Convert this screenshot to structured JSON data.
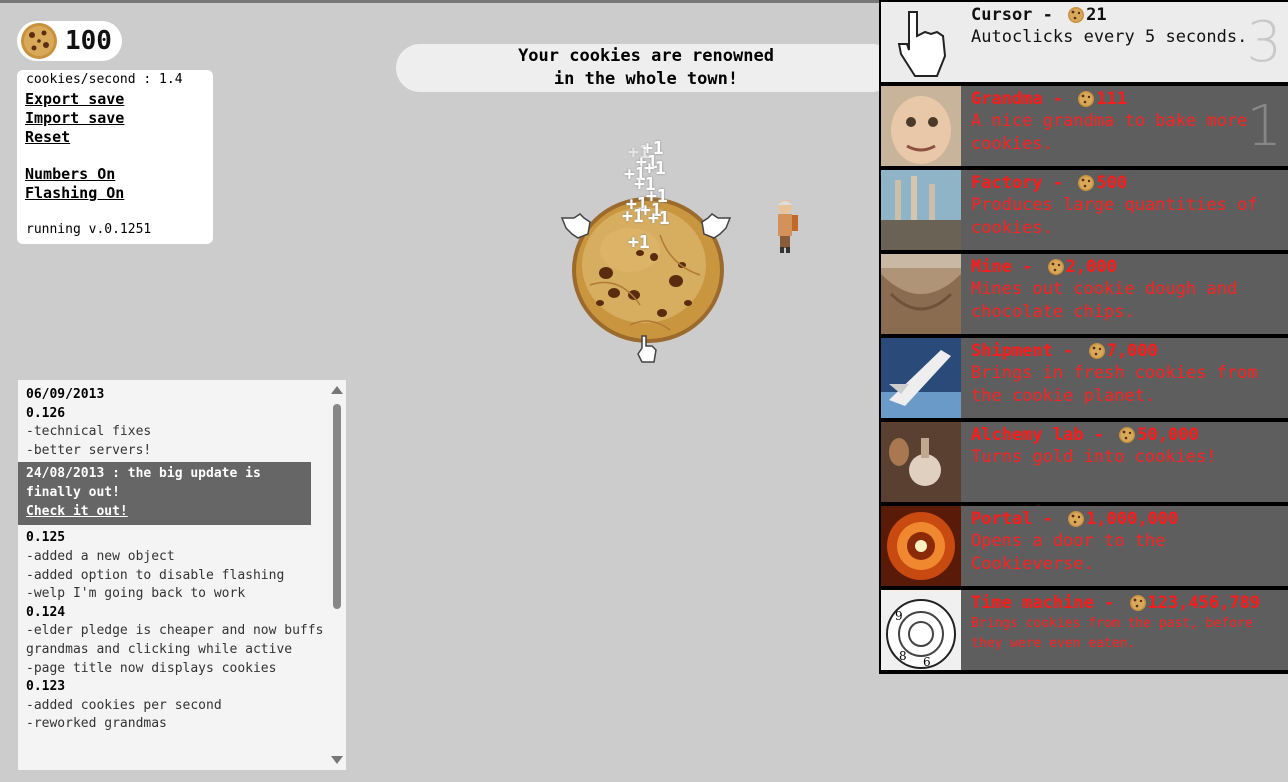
{
  "counter": {
    "value": "100"
  },
  "stats": {
    "cps": "cookies/second : 1.4",
    "export": "Export save",
    "import": "Import save",
    "reset": "Reset",
    "numbers": "Numbers On",
    "flashing": "Flashing On",
    "version": "running v.0.1251"
  },
  "banner": {
    "line1": "Your cookies are renowned",
    "line2": "in the whole town!"
  },
  "floating": {
    "label": "+1"
  },
  "changelog": {
    "date1": "06/09/2013",
    "v0126": "0.126",
    "l1": "-technical fixes",
    "l2": "-better servers!",
    "highlight_text": "24/08/2013 : the big update is finally out!",
    "highlight_link": "Check it out!",
    "v0125": "0.125",
    "l3": "-added a new object",
    "l4": "-added option to disable flashing",
    "l5": "-welp I'm going back to work",
    "v0124": "0.124",
    "l6": "-elder pledge is cheaper and now buffs grandmas and clicking while active",
    "l7": "-page title now displays cookies",
    "v0123": "0.123",
    "l8": "-added cookies per second",
    "l9": "-reworked grandmas"
  },
  "store": [
    {
      "name": "Cursor",
      "price": "21",
      "desc": "Autoclicks every 5 seconds.",
      "owned": "3",
      "affordable": true,
      "icon": "cursor-hand-icon"
    },
    {
      "name": "Grandma",
      "price": "111",
      "desc": "A nice grandma to bake more cookies.",
      "owned": "1",
      "affordable": false,
      "icon": "grandma-portrait"
    },
    {
      "name": "Factory",
      "price": "500",
      "desc": "Produces large quantities of cookies.",
      "owned": "",
      "affordable": false,
      "icon": "factory-photo"
    },
    {
      "name": "Mine",
      "price": "2,000",
      "desc": "Mines out cookie dough and chocolate chips.",
      "owned": "",
      "affordable": false,
      "icon": "mine-photo"
    },
    {
      "name": "Shipment",
      "price": "7,000",
      "desc": "Brings in fresh cookies from the cookie planet.",
      "owned": "",
      "affordable": false,
      "icon": "shuttle-photo"
    },
    {
      "name": "Alchemy lab",
      "price": "50,000",
      "desc": "Turns gold into cookies!",
      "owned": "",
      "affordable": false,
      "icon": "alchemy-photo"
    },
    {
      "name": "Portal",
      "price": "1,000,000",
      "desc": "Opens a door to the Cookieverse.",
      "owned": "",
      "affordable": false,
      "icon": "portal-photo"
    },
    {
      "name": "Time machine",
      "price": "123,456,789",
      "desc": "Brings cookies from the past, before they were even eaten.",
      "owned": "",
      "affordable": false,
      "icon": "clock-photo"
    }
  ],
  "colors": {
    "locked_text": "#ff1a1a",
    "locked_bg": "#5e5e5e",
    "affordable_bg": "#ececec",
    "page_bg": "#cccccc"
  }
}
